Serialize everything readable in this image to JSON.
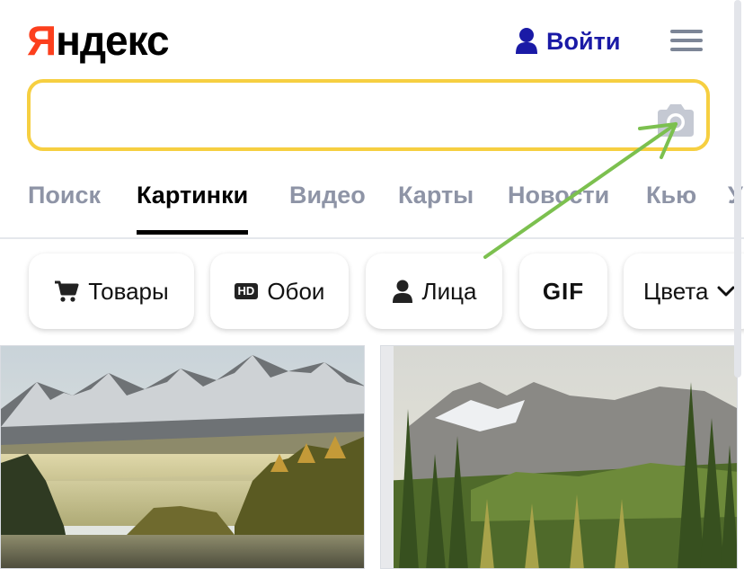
{
  "header": {
    "logo_first": "Я",
    "logo_rest": "ндекс",
    "login_label": "Войти",
    "login_icon": "user-icon",
    "menu_icon": "hamburger-menu-icon"
  },
  "search": {
    "value": "",
    "placeholder": "",
    "camera_icon": "camera-icon",
    "accent_color": "#f6cf41"
  },
  "tabs": [
    {
      "label": "Поиск",
      "active": false
    },
    {
      "label": "Картинки",
      "active": true
    },
    {
      "label": "Видео",
      "active": false
    },
    {
      "label": "Карты",
      "active": false
    },
    {
      "label": "Новости",
      "active": false
    },
    {
      "label": "Кью",
      "active": false
    },
    {
      "label": "У",
      "active": false
    }
  ],
  "filters": [
    {
      "label": "Товары",
      "icon": "cart-icon"
    },
    {
      "label": "Обои",
      "icon": "hd-icon",
      "badge": "HD"
    },
    {
      "label": "Лица",
      "icon": "person-icon"
    },
    {
      "label": "GIF"
    },
    {
      "label": "Цвета",
      "icon": "chevron-down-icon"
    }
  ],
  "images": [
    {
      "alt": "mountain-lake-image-1"
    },
    {
      "alt": "mountain-forest-image-2"
    }
  ],
  "colors": {
    "brand_red": "#fc3f1d",
    "link_blue": "#1a1aa6",
    "annotation_green": "#7cc04f"
  }
}
